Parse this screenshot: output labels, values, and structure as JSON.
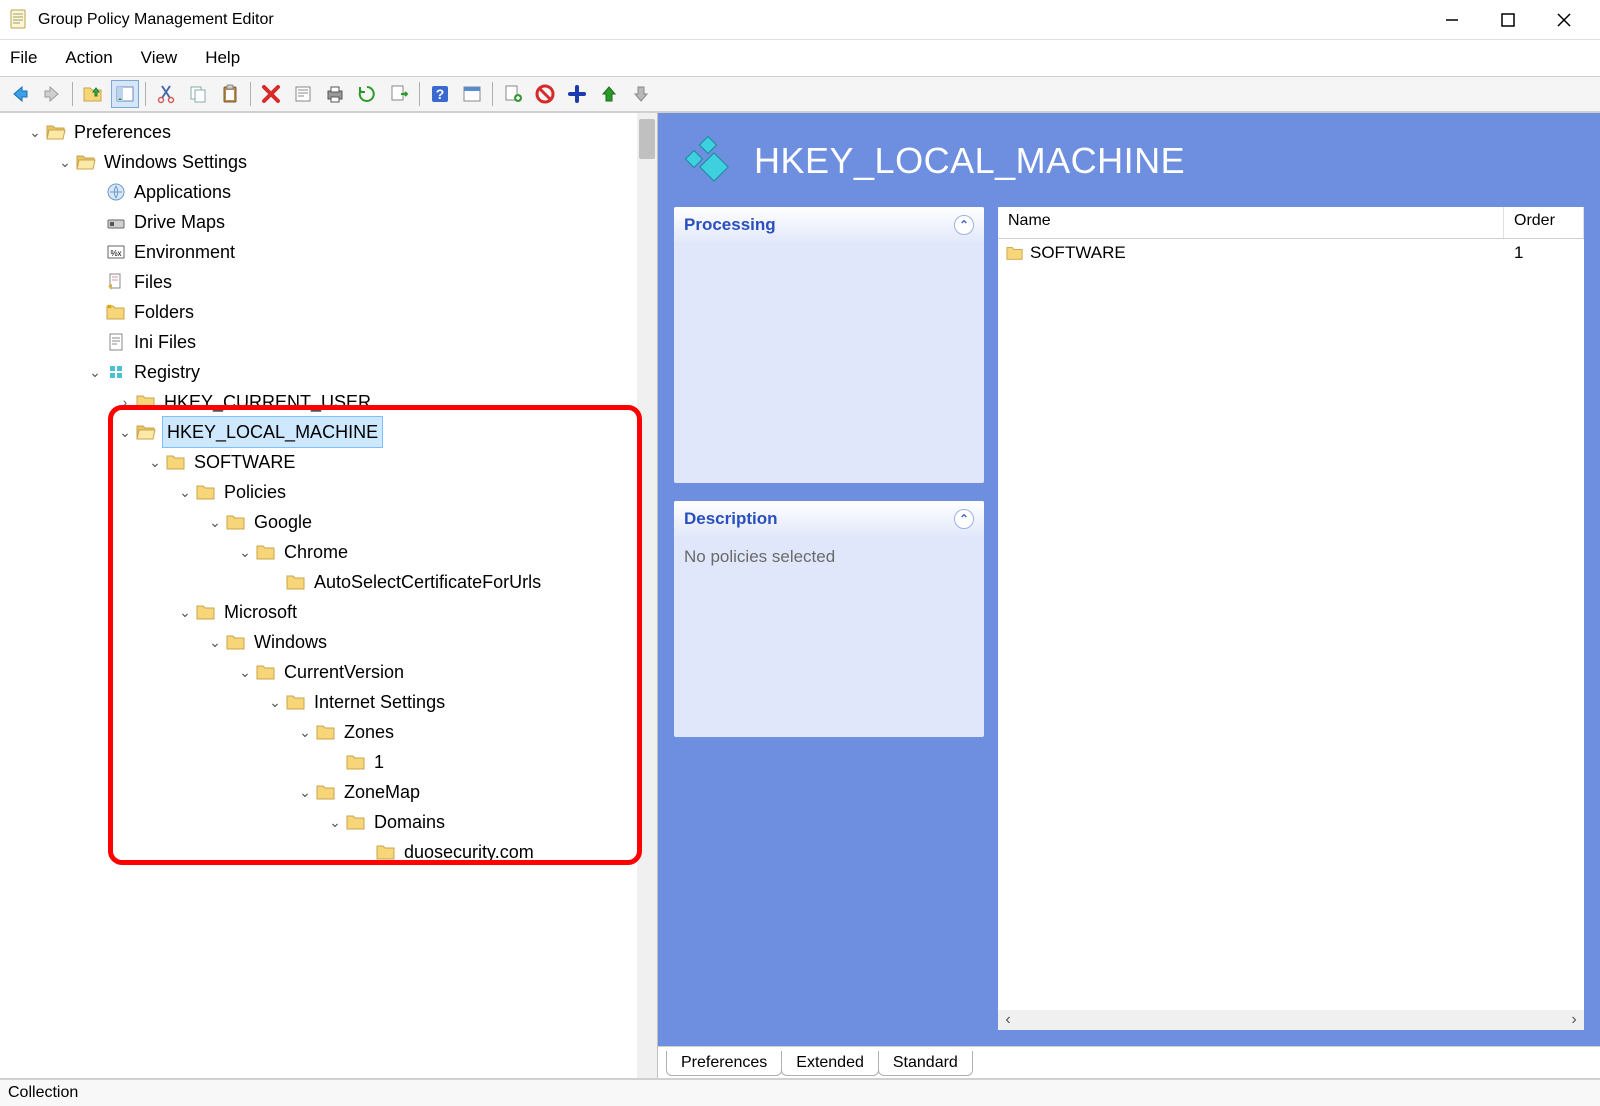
{
  "window": {
    "title": "Group Policy Management Editor"
  },
  "menubar": [
    "File",
    "Action",
    "View",
    "Help"
  ],
  "tree": {
    "preferences": "Preferences",
    "windows_settings": "Windows Settings",
    "applications": "Applications",
    "drive_maps": "Drive Maps",
    "environment": "Environment",
    "files": "Files",
    "folders": "Folders",
    "ini_files": "Ini Files",
    "registry": "Registry",
    "hkcu": "HKEY_CURRENT_USER",
    "hklm": "HKEY_LOCAL_MACHINE",
    "software": "SOFTWARE",
    "policies": "Policies",
    "google": "Google",
    "chrome": "Chrome",
    "autoselect": "AutoSelectCertificateForUrls",
    "microsoft": "Microsoft",
    "windows": "Windows",
    "currentversion": "CurrentVersion",
    "internet_settings": "Internet Settings",
    "zones": "Zones",
    "one": "1",
    "zonemap": "ZoneMap",
    "domains": "Domains",
    "duosecurity": "duosecurity.com"
  },
  "right": {
    "title": "HKEY_LOCAL_MACHINE",
    "processing_header": "Processing",
    "description_header": "Description",
    "description_body": "No policies selected",
    "list_cols": {
      "name": "Name",
      "order": "Order"
    },
    "list_row1": {
      "name": "SOFTWARE",
      "order": "1"
    }
  },
  "tabs": [
    "Preferences",
    "Extended",
    "Standard"
  ],
  "status": "Collection"
}
